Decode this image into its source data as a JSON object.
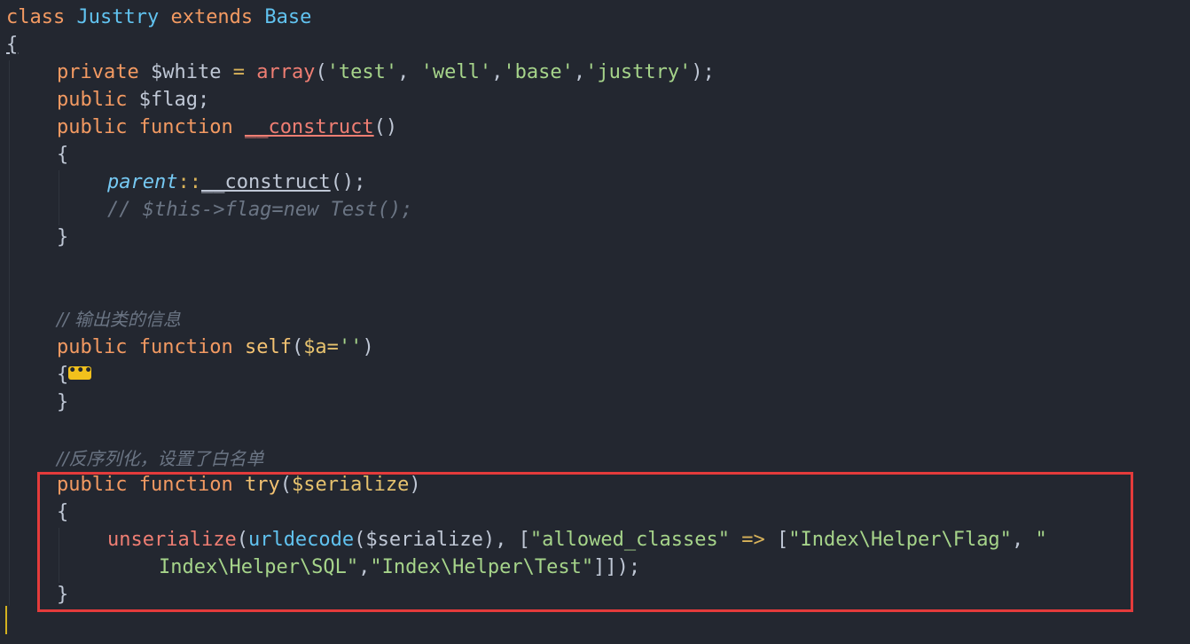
{
  "code": {
    "l1": {
      "k1": "class",
      "name": "Justtry",
      "k2": "extends",
      "base": "Base"
    },
    "l2": {
      "brace": "{"
    },
    "l3": {
      "mod": "private",
      "var": "$white",
      "eq": " = ",
      "fn": "array",
      "rest_open": "(",
      "s1": "'test'",
      "c1": ", ",
      "s2": "'well'",
      "c2": ",",
      "s3": "'base'",
      "c3": ",",
      "s4": "'justtry'",
      "rest_close": ");"
    },
    "l4": {
      "mod": "public",
      "var": "$flag",
      "semi": ";"
    },
    "l5": {
      "mod": "public",
      "kw": "function",
      "fn": "__construct",
      "paren": "()"
    },
    "l6": {
      "brace": "{"
    },
    "l7": {
      "parent": "parent",
      "sep": "::",
      "fn": "__construct",
      "rest": "();"
    },
    "l8": {
      "comment": "// $this->flag=new Test();"
    },
    "l9": {
      "brace": "}"
    },
    "l10": {
      "comment": "// 输出类的信息"
    },
    "l11": {
      "mod": "public",
      "kw": "function",
      "fn": "self",
      "p_open": "(",
      "param": "$a=",
      "str": "''",
      "p_close": ")"
    },
    "l12": {
      "brace": "{",
      "fold": "•••"
    },
    "l13": {
      "brace": "}"
    },
    "l14": {
      "comment": "//反序列化，设置了白名单"
    },
    "l15": {
      "mod": "public",
      "kw": "function",
      "fn": "try",
      "p_open": "(",
      "param": "$serialize",
      "p_close": ")"
    },
    "l16": {
      "brace": "{"
    },
    "l17": {
      "fn1": "unserialize",
      "o1": "(",
      "fn2": "urldecode",
      "o2": "(",
      "arg": "$serialize",
      "o3": "), [",
      "key": "\"allowed_classes\"",
      "arrow": " => ",
      "o4": "[",
      "s1": "\"Index\\Helper\\Flag\"",
      "c1": ", ",
      "q": "\""
    },
    "l18": {
      "s2": "Index\\Helper\\SQL\"",
      "c2": ",",
      "s3": "\"Index\\Helper\\Test\"",
      "close": "]]);"
    },
    "l19": {
      "brace": "}"
    }
  },
  "colors": {
    "background": "#232730",
    "highlight_box": "#e43b3b",
    "cursor": "#d4b21f"
  }
}
